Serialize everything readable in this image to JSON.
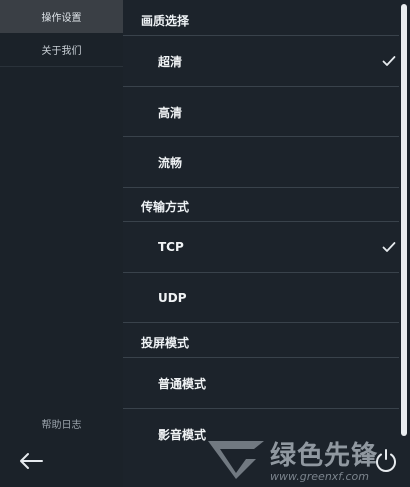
{
  "sidebar": {
    "items": [
      {
        "label": "操作设置",
        "active": true
      },
      {
        "label": "关于我们",
        "active": false
      }
    ],
    "bottom_label": "帮助日志"
  },
  "settings": {
    "sections": [
      {
        "title": "画质选择",
        "options": [
          {
            "label": "超清",
            "checked": true
          },
          {
            "label": "高清",
            "checked": false
          },
          {
            "label": "流畅",
            "checked": false
          }
        ]
      },
      {
        "title": "传输方式",
        "options": [
          {
            "label": "TCP",
            "checked": true
          },
          {
            "label": "UDP",
            "checked": false
          }
        ]
      },
      {
        "title": "投屏模式",
        "options": [
          {
            "label": "普通模式",
            "checked": false
          },
          {
            "label": "影音模式",
            "checked": false
          }
        ]
      }
    ]
  },
  "watermark": {
    "brand": "绿色先锋",
    "url": "www.greenxf.com"
  },
  "colors": {
    "background": "#1c232b",
    "sidebar_active": "#3a3f45",
    "separator": "#39424b",
    "scrollbar_thumb": "#e9ecef"
  },
  "icons": {
    "back": "arrow-left-icon",
    "check": "check-icon",
    "power": "power-icon"
  }
}
